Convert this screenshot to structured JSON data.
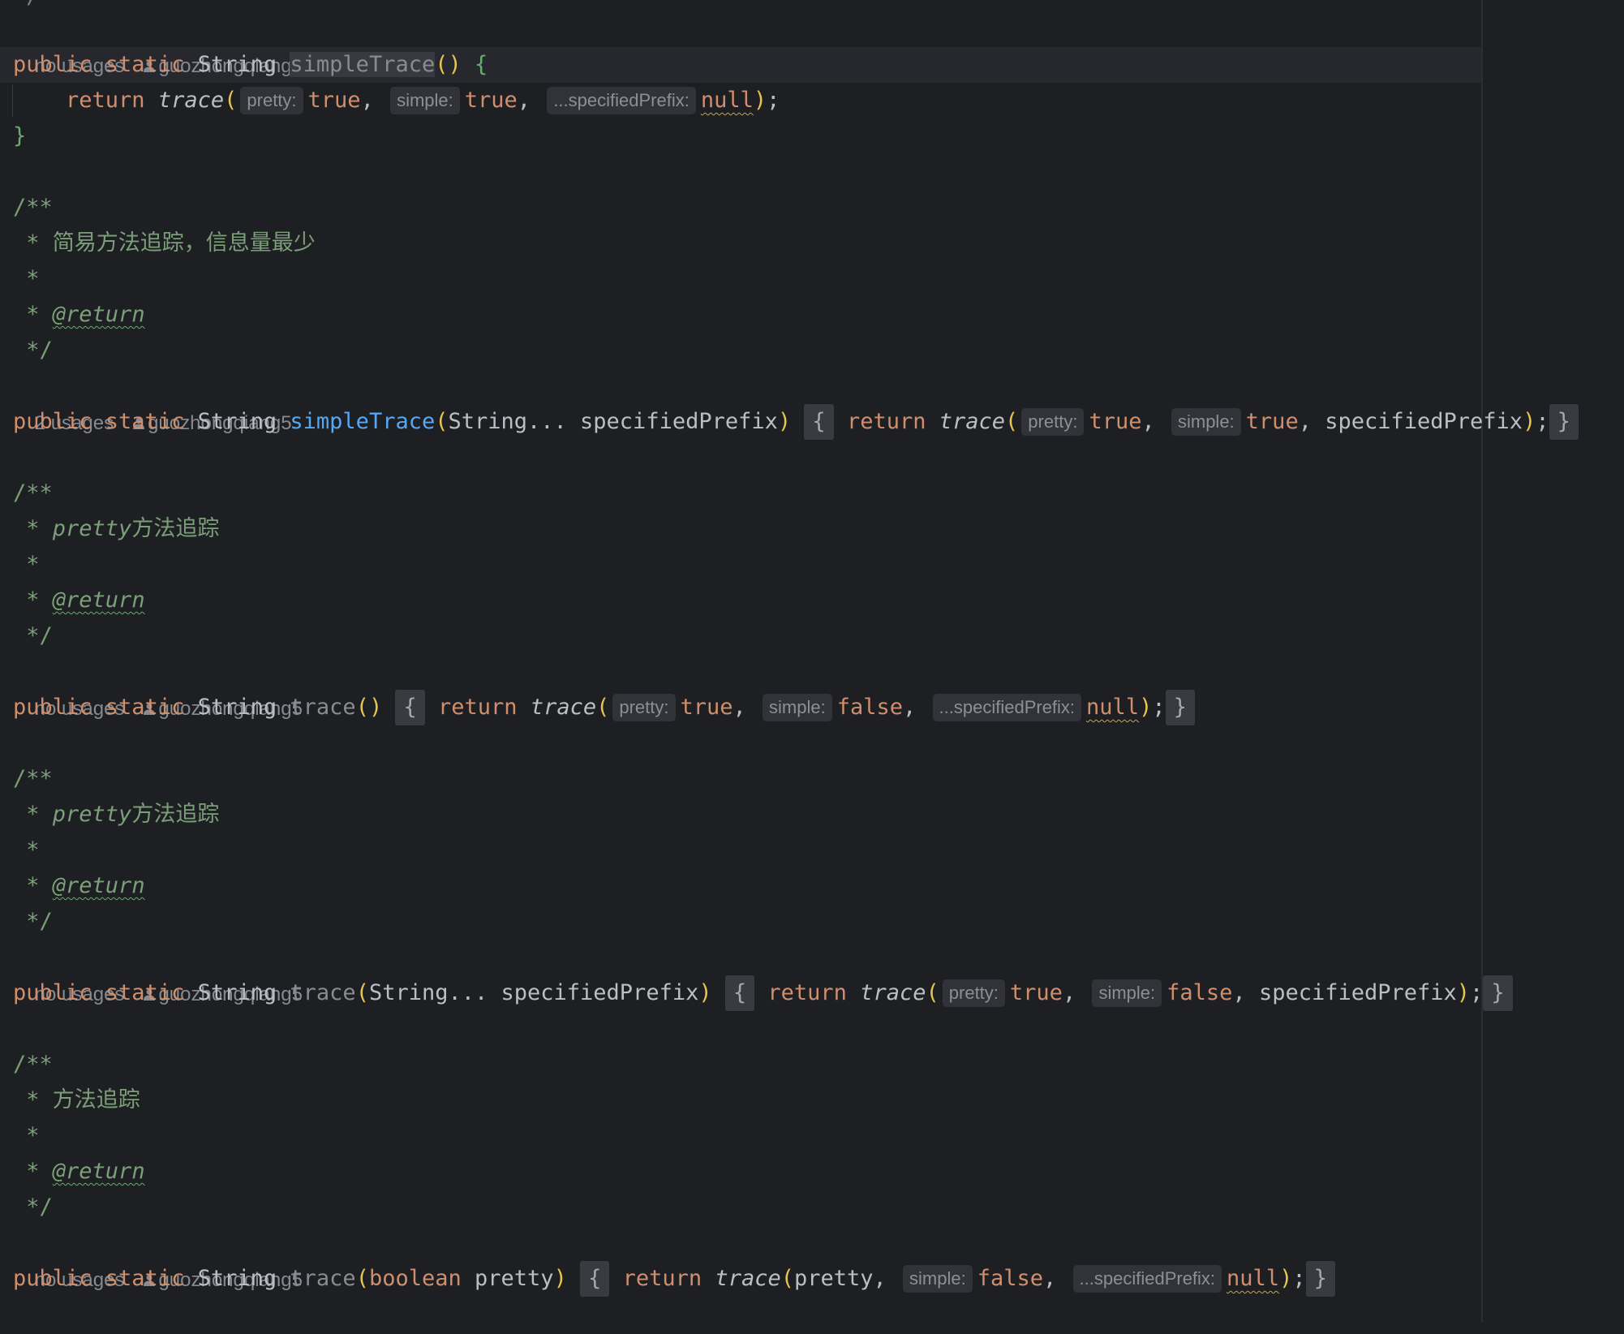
{
  "author": "guozhongqiang5",
  "blocks": [
    {
      "usages": "no usages",
      "signature": {
        "mods": "public static",
        "type": "String",
        "name": "simpleTrace",
        "params": ""
      },
      "body_line": {
        "ret": "return",
        "call": "trace",
        "hint1": "pretty:",
        "arg1": "true",
        "hint2": "simple:",
        "arg2": "true",
        "hint3": "...specifiedPrefix:",
        "arg3": "null"
      },
      "close": "}"
    },
    {
      "doc": [
        "/**",
        " * 简易方法追踪，信息量最少",
        " *",
        " * @return",
        " */"
      ],
      "usages": "2 usages",
      "signature": {
        "mods": "public static",
        "type": "String",
        "name": "simpleTrace",
        "params": "String... specifiedPrefix"
      },
      "inline": {
        "ret": "return",
        "call": "trace",
        "hint1": "pretty:",
        "arg1": "true",
        "hint2": "simple:",
        "arg2": "true",
        "arg3": "specifiedPrefix"
      }
    },
    {
      "doc": [
        "/**",
        " * pretty方法追踪",
        " *",
        " * @return",
        " */"
      ],
      "usages": "no usages",
      "signature": {
        "mods": "public static",
        "type": "String",
        "name": "trace",
        "params": ""
      },
      "inline": {
        "ret": "return",
        "call": "trace",
        "hint1": "pretty:",
        "arg1": "true",
        "hint2": "simple:",
        "arg2": "false",
        "hint3": "...specifiedPrefix:",
        "arg3": "null"
      }
    },
    {
      "doc": [
        "/**",
        " * pretty方法追踪",
        " *",
        " * @return",
        " */"
      ],
      "usages": "no usages",
      "signature": {
        "mods": "public static",
        "type": "String",
        "name": "trace",
        "params": "String... specifiedPrefix"
      },
      "inline": {
        "ret": "return",
        "call": "trace",
        "hint1": "pretty:",
        "arg1": "true",
        "hint2": "simple:",
        "arg2": "false",
        "arg3": "specifiedPrefix"
      }
    },
    {
      "doc": [
        "/**",
        " * 方法追踪",
        " *",
        " * @return",
        " */"
      ],
      "usages": "no usages",
      "signature": {
        "mods": "public static",
        "type": "String",
        "name": "trace",
        "params": "boolean pretty"
      },
      "inline": {
        "ret": "return",
        "call": "trace",
        "arg1": "pretty",
        "hint2": "simple:",
        "arg2": "false",
        "hint3": "...specifiedPrefix:",
        "arg3": "null"
      }
    }
  ],
  "tokens": {
    "public": "public",
    "static": "static",
    "String": "String",
    "boolean": "boolean",
    "varargs": "String...",
    "fold_open": "{",
    "fold_close": "}",
    "top_fragment": "*/"
  }
}
